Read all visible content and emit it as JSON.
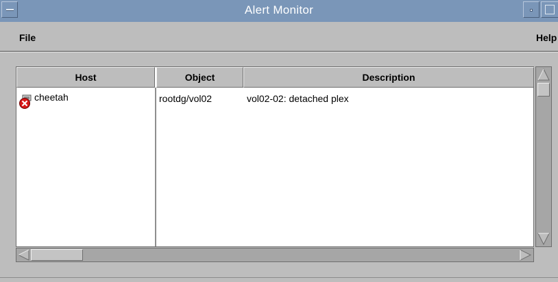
{
  "window": {
    "title": "Alert Monitor"
  },
  "menubar": {
    "file_label": "File",
    "help_label": "Help"
  },
  "table": {
    "columns": [
      "Host",
      "Object",
      "Description"
    ],
    "rows": [
      {
        "status_icon": "error-icon",
        "host": "cheetah",
        "object": "rootdg/vol02",
        "description": "vol02-02: detached plex"
      }
    ]
  },
  "colors": {
    "titlebar": "#7a96b8",
    "window_bg": "#bdbdbd",
    "alert_red": "#d81818"
  }
}
